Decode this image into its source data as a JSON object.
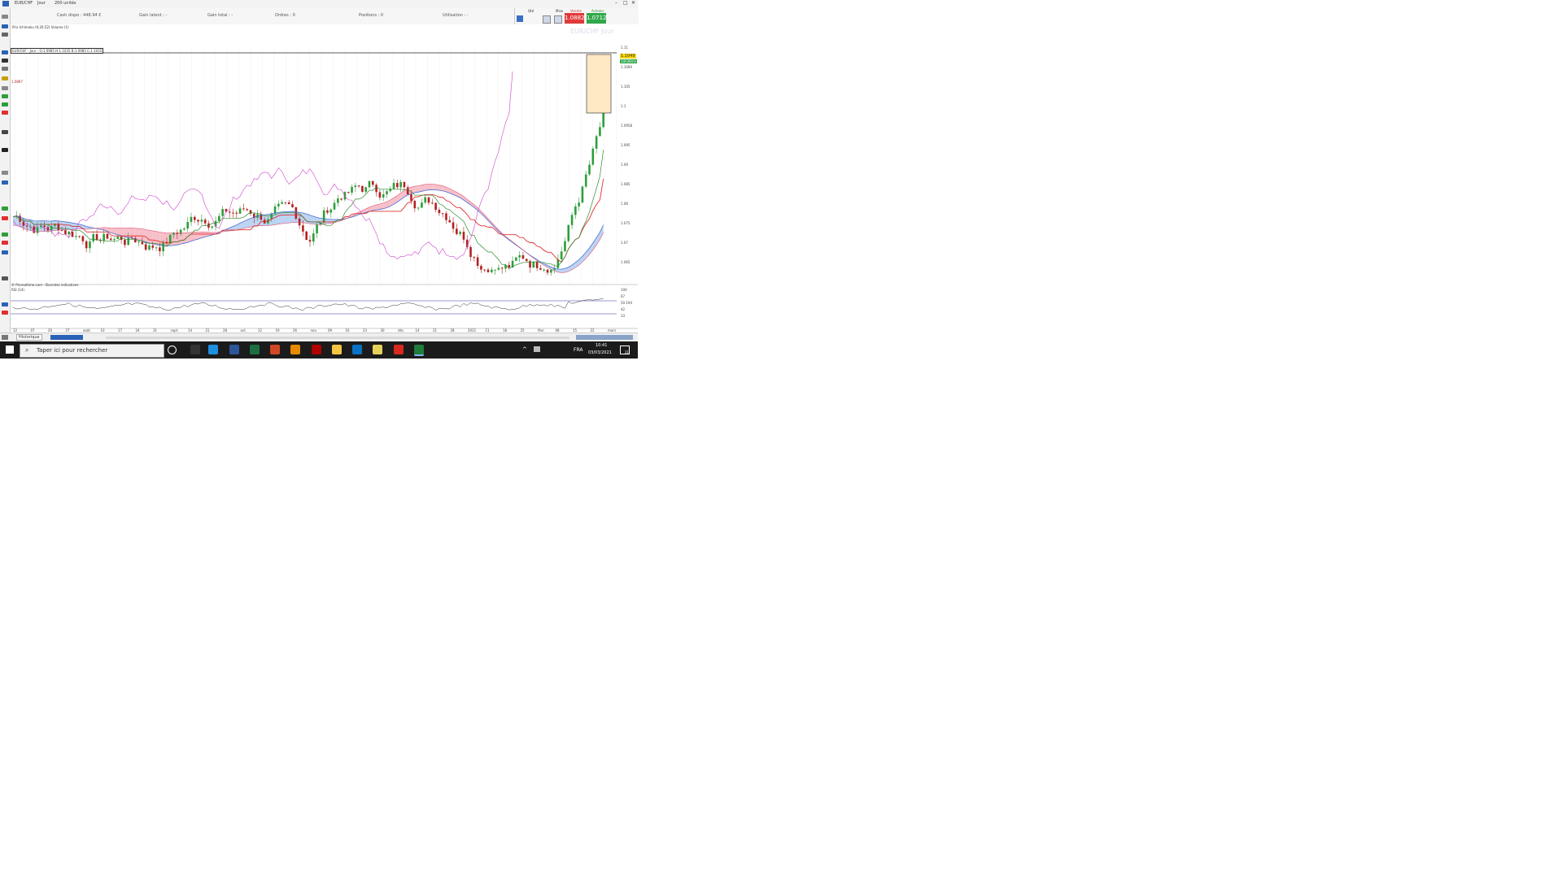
{
  "window": {
    "instrument": "EUR/CHF",
    "period": "Jour",
    "units": "200 unités",
    "controls": [
      "–",
      "□",
      "✕"
    ]
  },
  "toolbar": {
    "items": [
      {
        "label": "Cash dispo : 448.94 €"
      },
      {
        "label": "Gain latent : -"
      },
      {
        "label": "Gain total : -"
      },
      {
        "label": "Ordres : 0"
      },
      {
        "label": "Positions : 0"
      },
      {
        "label": "Utilisation : -"
      }
    ]
  },
  "trade": {
    "sell_label": "Vendre",
    "buy_label": "Acheter",
    "sell_price": "1.0882",
    "buy_price": "1.0712",
    "qty_label": "Qté",
    "amount_label": "Mise",
    "watermark": "EUR/CHF Jour"
  },
  "chart": {
    "header": "EUR/CHF - Jour - O:1.0985 H:1.1035 B:1.0985 C:1.1035",
    "indicators_line": "Prix   Ichimoku (9,26,52)   Volume (1)",
    "left_level": "1.0897",
    "price_labels": [
      "1.11",
      "1.1090",
      "1.105",
      "1.1",
      "1.0958",
      "1.095",
      "1.09",
      "1.085",
      "1.08",
      "1.075",
      "1.07",
      "1.065"
    ],
    "current_price": "1.1049",
    "countdown": "14h38mn",
    "rsi_title": "RSI (14)",
    "rsi_labels": [
      "100",
      "67",
      "50.194",
      "42",
      "33"
    ],
    "lower_note": "© Prorealtime.com - Données indicatives",
    "x_labels": [
      "12",
      "07",
      "20",
      "27",
      "août",
      "10",
      "17",
      "24",
      "31",
      "sept.",
      "14",
      "21",
      "28",
      "oct.",
      "12",
      "19",
      "26",
      "nov.",
      "09",
      "16",
      "23",
      "30",
      "déc.",
      "14",
      "21",
      "28",
      "2021",
      "11",
      "18",
      "25",
      "févr.",
      "08",
      "15",
      "22",
      "mars"
    ],
    "colors": {
      "bull": "#2e9e3a",
      "bear": "#b22222",
      "kijun": "#e03030",
      "tenkan": "#2e8b2e",
      "chikou": "#cc44cc",
      "cloud_bull": "#bcd3f2",
      "cloud_bear": "#f6bfc9",
      "rsi": "#333333",
      "rect": "#fde9c4"
    }
  },
  "statusbar": {
    "tab_label": "Historique"
  },
  "taskbar": {
    "search_placeholder": "Taper ici pour rechercher",
    "lang": "FRA",
    "time": "10:41",
    "date": "03/03/2021",
    "notif_count": "21"
  }
}
